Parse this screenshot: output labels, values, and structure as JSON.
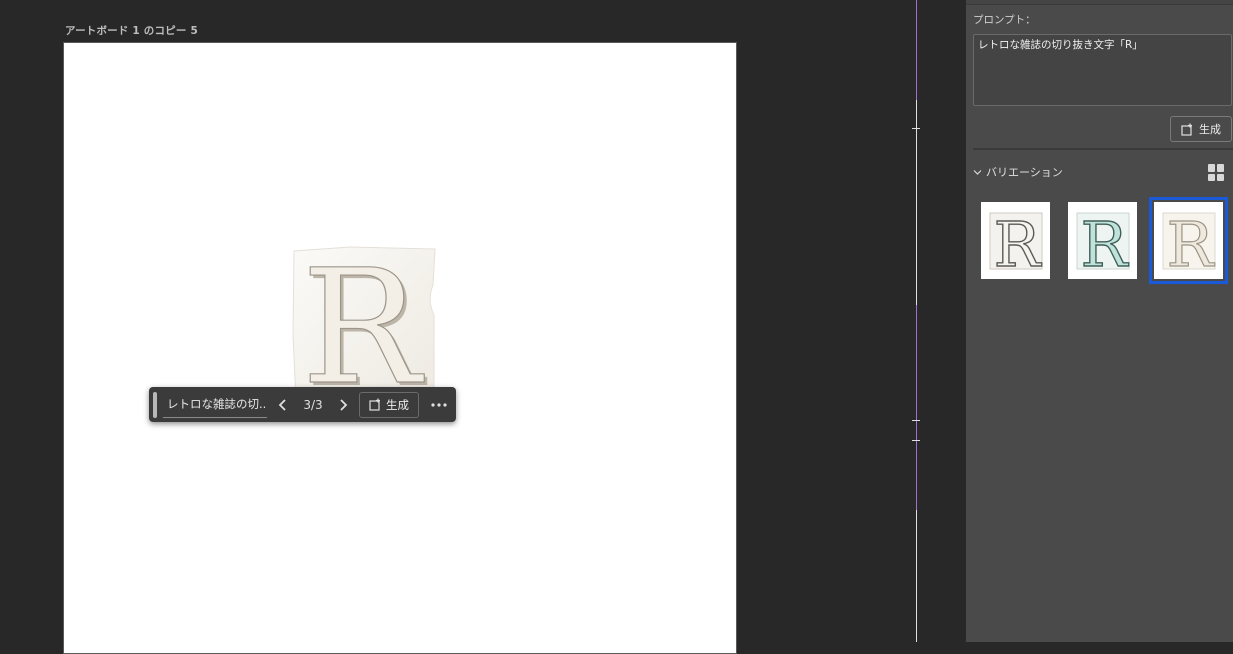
{
  "artboard": {
    "title": "アートボード 1 のコピー 5"
  },
  "toolbar": {
    "prompt_short": "レトロな雑誌の切...",
    "counter": "3/3",
    "generate_label": "生成",
    "prev_icon": "chevron-left-icon",
    "next_icon": "chevron-right-icon",
    "more_icon": "more-horizontal-icon"
  },
  "panel": {
    "prompt_label": "プロンプト：",
    "prompt_value": "レトロな雑誌の切り抜き文字「R」",
    "generate_label": "生成",
    "variations_label": "バリエーション",
    "selected_variation": 3,
    "variation_count": 3
  },
  "canvas": {
    "letter": "R"
  },
  "colors": {
    "accent_selection": "#1a5ad8",
    "guide": "#a070d0",
    "panel_bg": "#4a4a4a",
    "canvas_bg": "#282828"
  }
}
